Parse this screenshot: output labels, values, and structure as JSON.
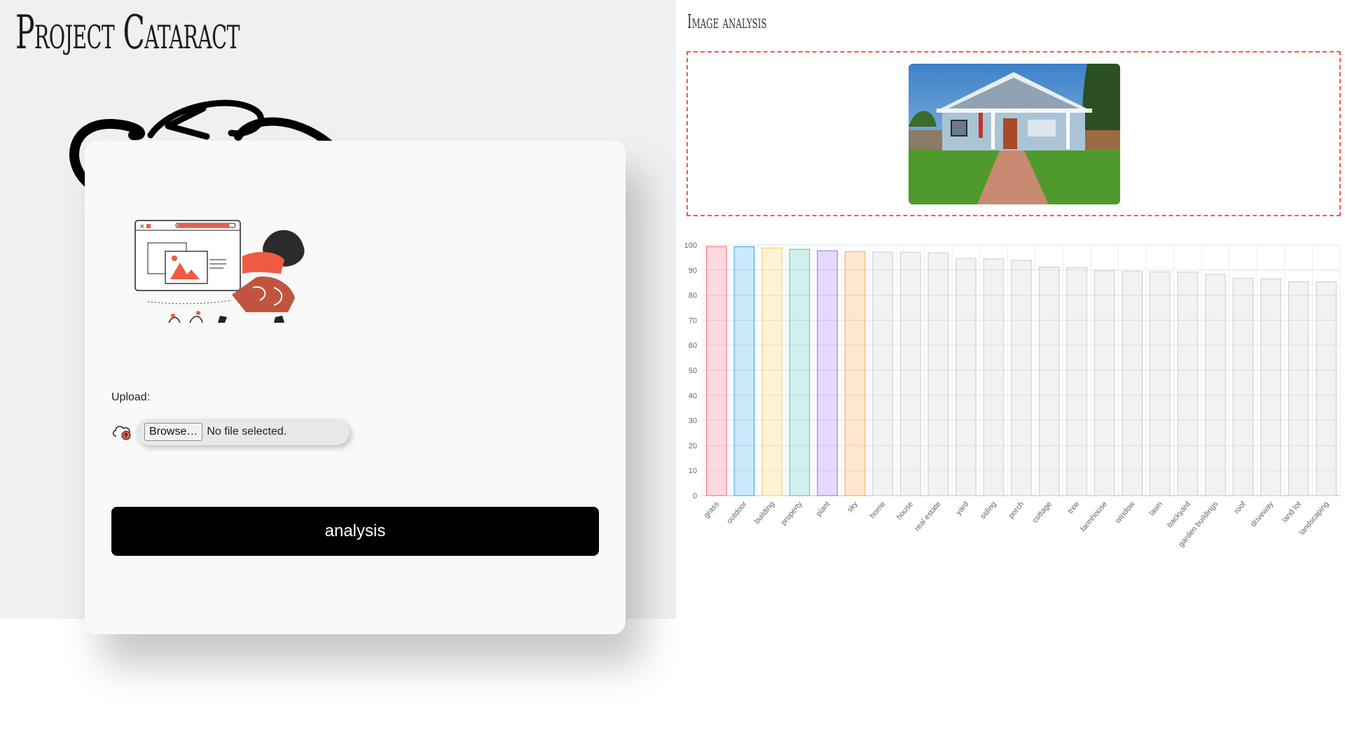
{
  "header": {
    "title": "Project Cataract"
  },
  "upload": {
    "label": "Upload:",
    "browse_label": "Browse…",
    "file_status": "No file selected.",
    "submit_label": "analysis"
  },
  "results": {
    "title": "Image analysis"
  },
  "colors": {
    "accent": "#ef5a42",
    "button_bg": "#000000",
    "card_bg": "#f9f9f9",
    "page_bg": "#f0f0f0"
  },
  "chart_data": {
    "type": "bar",
    "title": "",
    "xlabel": "",
    "ylabel": "",
    "ylim": [
      0,
      100
    ],
    "yticks": [
      0,
      10,
      20,
      30,
      40,
      50,
      60,
      70,
      80,
      90,
      100
    ],
    "grid": true,
    "categories": [
      "grass",
      "outdoor",
      "building",
      "property",
      "plant",
      "sky",
      "home",
      "house",
      "real estate",
      "yard",
      "siding",
      "porch",
      "cottage",
      "tree",
      "farmhouse",
      "window",
      "lawn",
      "backyard",
      "garden buildings",
      "roof",
      "driveway",
      "land lot",
      "landscaping"
    ],
    "values": [
      99.4,
      99.3,
      98.8,
      98.3,
      97.7,
      97.4,
      97.2,
      97.1,
      96.9,
      94.6,
      94.4,
      93.9,
      91.2,
      91.0,
      89.8,
      89.4,
      89.3,
      89.2,
      88.3,
      86.7,
      86.5,
      85.4,
      85.3
    ],
    "bar_colors": [
      "#ff6384",
      "#36a2eb",
      "#ffcd56",
      "#4bc0c0",
      "#9966ff",
      "#ff9f40",
      "#c9cbcf",
      "#c9cbcf",
      "#c9cbcf",
      "#c9cbcf",
      "#c9cbcf",
      "#c9cbcf",
      "#c9cbcf",
      "#c9cbcf",
      "#c9cbcf",
      "#c9cbcf",
      "#c9cbcf",
      "#c9cbcf",
      "#c9cbcf",
      "#c9cbcf",
      "#c9cbcf",
      "#c9cbcf",
      "#c9cbcf"
    ]
  }
}
